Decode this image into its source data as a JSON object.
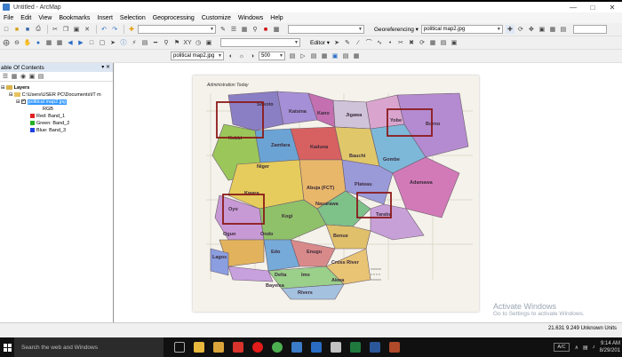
{
  "window": {
    "title": "Untitled - ArcMap"
  },
  "menu": [
    "File",
    "Edit",
    "View",
    "Bookmarks",
    "Insert",
    "Selection",
    "Geoprocessing",
    "Customize",
    "Windows",
    "Help"
  ],
  "toolbar": {
    "georeferencing_label": "Georeferencing ▾",
    "georef_layer": "political map2.jpg",
    "editor_label": "Editor ▾",
    "layer_combo": "political map2.jpg",
    "zoom_combo": "500"
  },
  "toc": {
    "header": "able Of Contents",
    "layers_label": "Layers",
    "folder_path": "C:\\Users\\USER PC\\Documents\\IT m",
    "layer_name": "political map2.jpg",
    "rgb_label": "RGB",
    "bands": [
      {
        "label": "Red:  Band_1",
        "color": "#e02020"
      },
      {
        "label": "Green: Band_2",
        "color": "#22b022"
      },
      {
        "label": "Blue:  Band_3",
        "color": "#2040e0"
      }
    ]
  },
  "map": {
    "sheet_title": "Administration Today",
    "states": [
      "Sokoto",
      "Katsina",
      "Kano",
      "Jigawa",
      "Yobe",
      "Borno",
      "Kebbi",
      "Zamfara",
      "Kaduna",
      "Bauchi",
      "Gombe",
      "Niger",
      "Adamawa",
      "Kwara",
      "Plateau",
      "Abuja (FCT)",
      "Nasarawa",
      "Taraba",
      "Oyo",
      "Kogi",
      "Benue",
      "Ogun",
      "Ondo",
      "Edo",
      "Enugu",
      "Lagos",
      "Delta",
      "Imo",
      "Cross River",
      "Bayelsa",
      "Rivers",
      "Akwa"
    ],
    "highlight_color": "#8b1a1a"
  },
  "status": {
    "coords": "21.631  9.249 Unknown Units"
  },
  "watermark": {
    "line1": "Activate Windows",
    "line2": "Go to Settings to activate Windows."
  },
  "taskbar": {
    "search_placeholder": "Search the web and Windows",
    "time": "9:14 AM",
    "date": "8/29/201",
    "ac": "A/C"
  }
}
